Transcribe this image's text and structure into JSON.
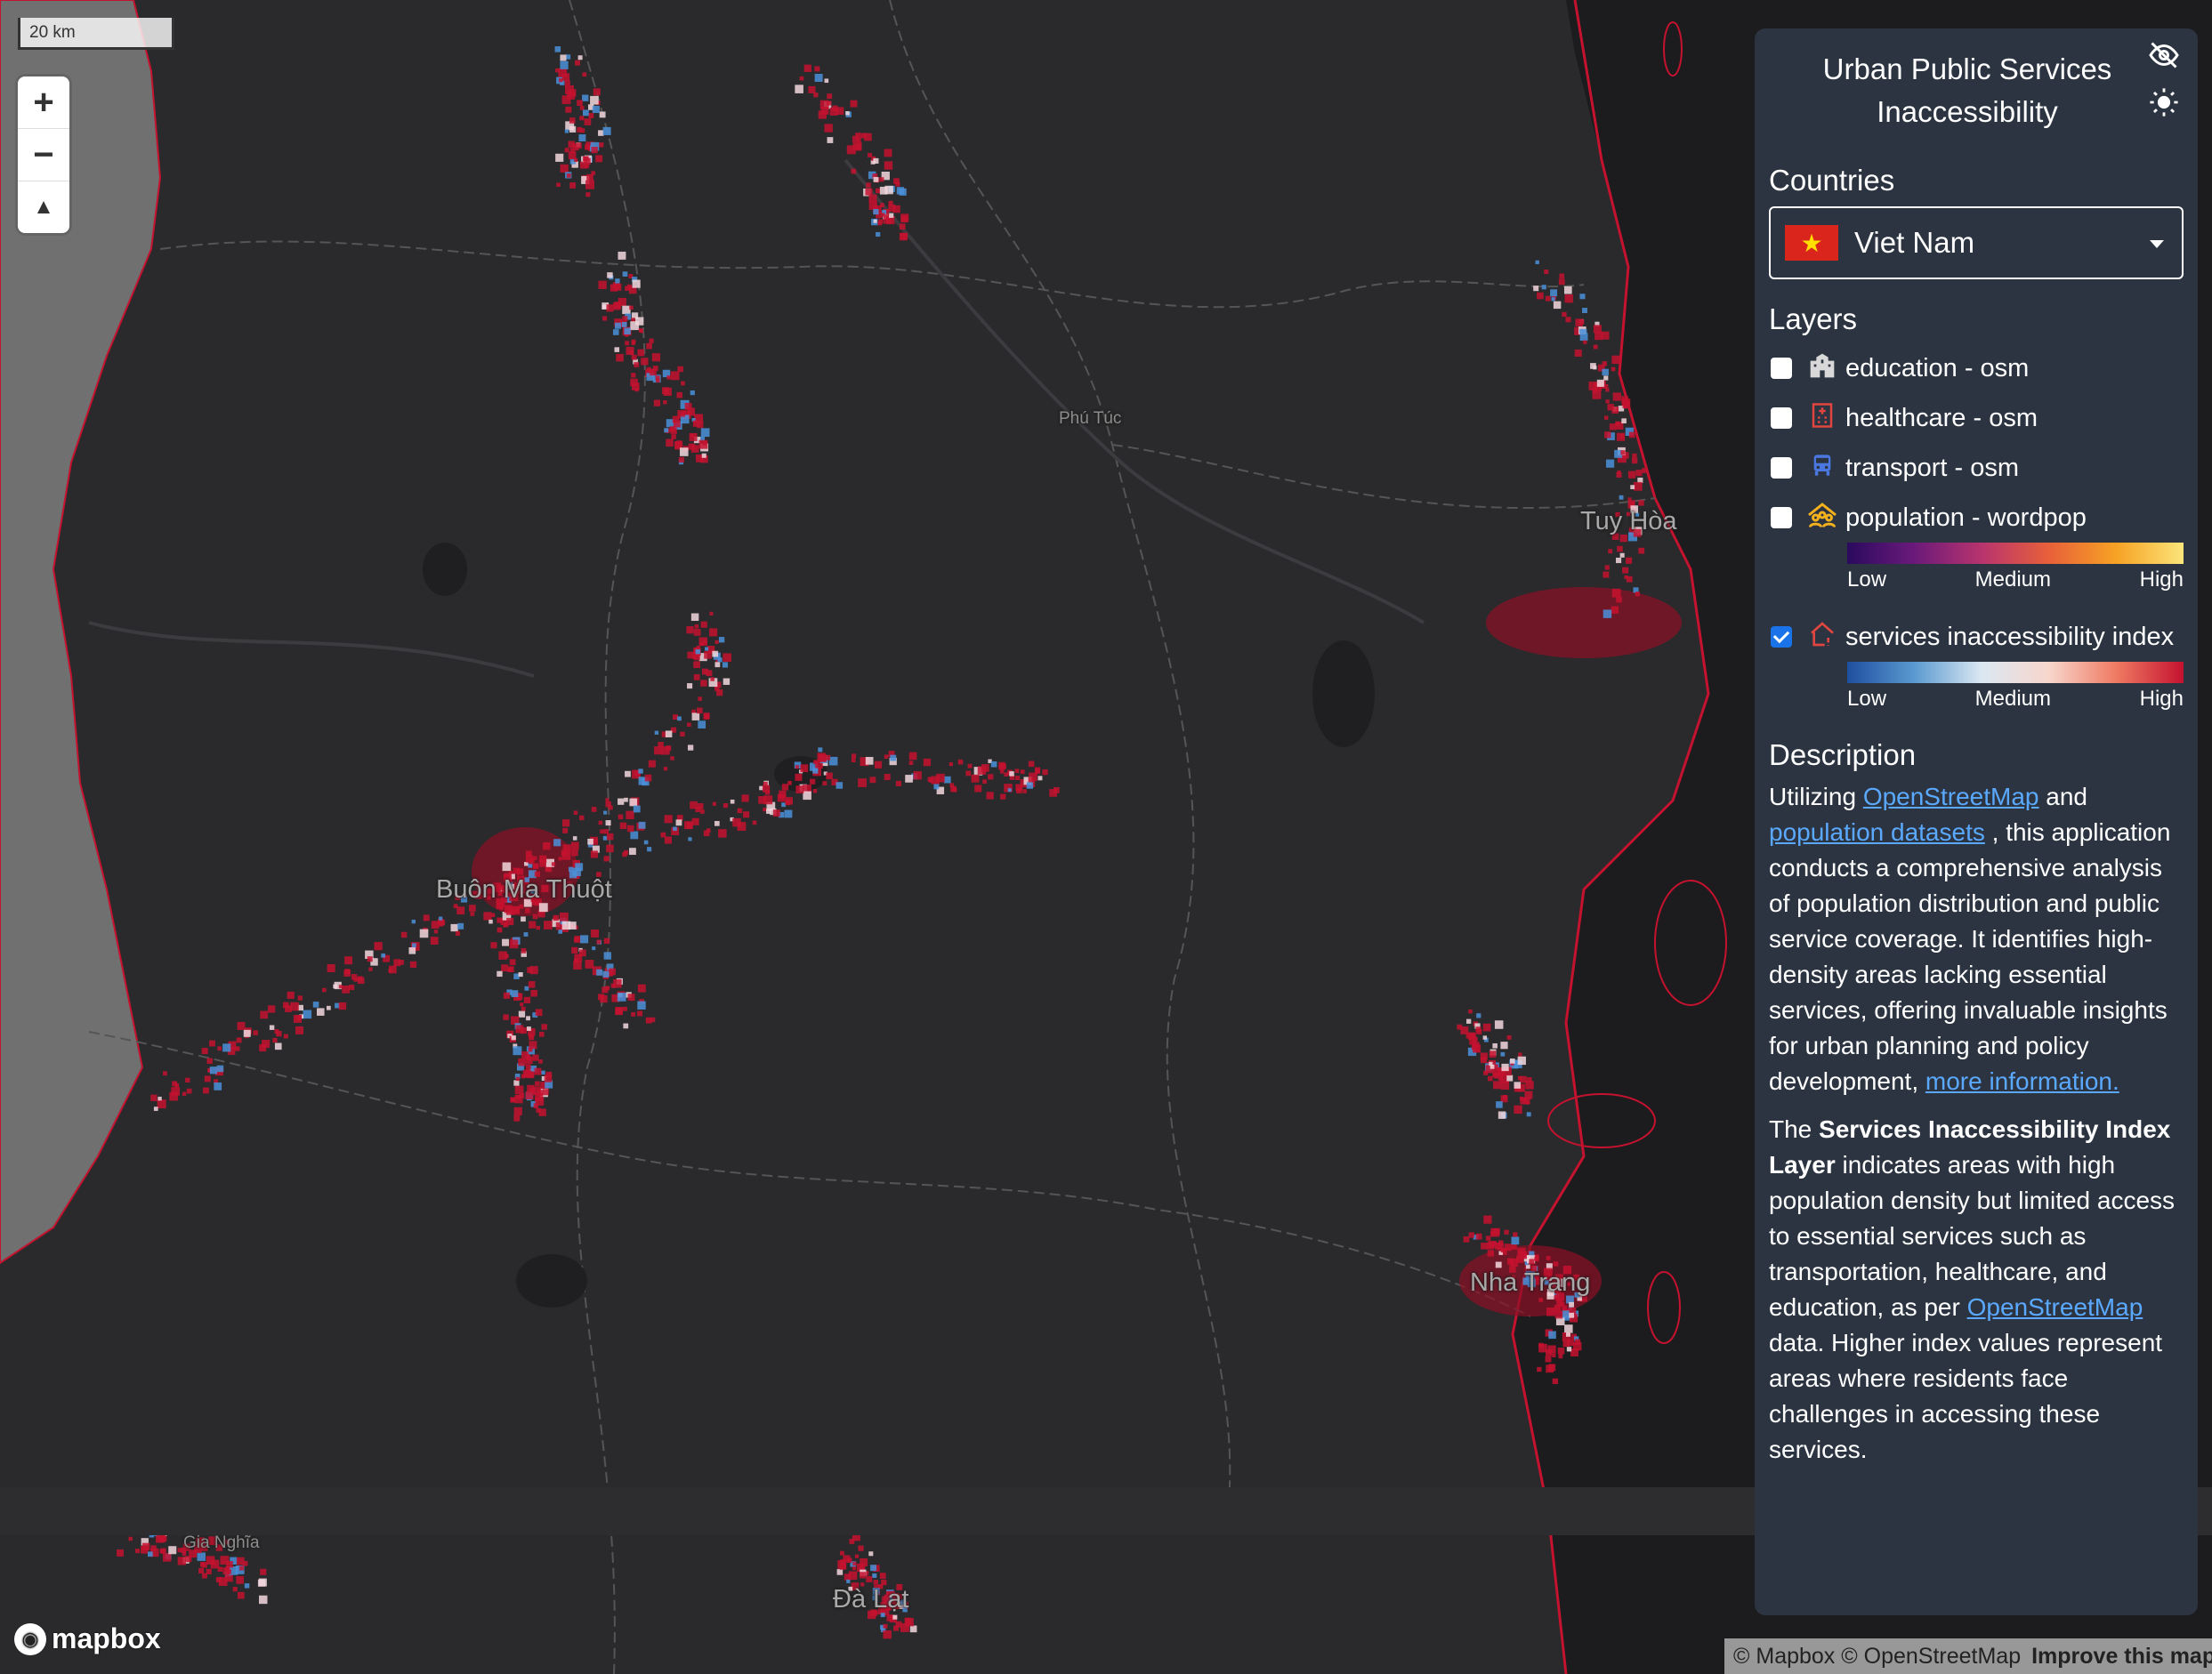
{
  "map": {
    "scale": "20 km",
    "cities": [
      {
        "name": "Phú Túc",
        "size": "small"
      },
      {
        "name": "Tuy Hòa",
        "size": "large"
      },
      {
        "name": "Buôn Ma Thuột",
        "size": "large"
      },
      {
        "name": "Nha Trang",
        "size": "large"
      },
      {
        "name": "Gia Nghĩa",
        "size": "small"
      },
      {
        "name": "Đà Lạt",
        "size": "large"
      }
    ],
    "colors": {
      "land": "#2a2a2c",
      "sea": "#1b1b1d",
      "neighbor": "#707070",
      "hotspot": "#c4122f",
      "access": "#4a90d9"
    }
  },
  "controls": {
    "zoom_in": "+",
    "zoom_out": "−",
    "compass": "▲"
  },
  "attribution": {
    "logo": "mapbox",
    "text": "© Mapbox © OpenStreetMap",
    "improve": "Improve this map"
  },
  "panel": {
    "title": "Urban Public Services Inaccessibility",
    "icons": [
      "eye-off-icon",
      "sun-icon"
    ],
    "countries_heading": "Countries",
    "country_selected": "Viet Nam",
    "layers_heading": "Layers",
    "layers": [
      {
        "label": "education - osm",
        "checked": false,
        "icon": "school-icon",
        "color": "#d8d8d8"
      },
      {
        "label": "healthcare - osm",
        "checked": false,
        "icon": "hospital-icon",
        "color": "#e0453f"
      },
      {
        "label": "transport - osm",
        "checked": false,
        "icon": "bus-icon",
        "color": "#4a78e0"
      },
      {
        "label": "population - wordpop",
        "checked": false,
        "icon": "people-icon",
        "color": "#f5b21d"
      },
      {
        "label": "services inaccessibility index",
        "checked": true,
        "icon": "house-alert-icon",
        "color": "#e0453f"
      }
    ],
    "legend_population": {
      "low": "Low",
      "medium": "Medium",
      "high": "High"
    },
    "legend_index": {
      "low": "Low",
      "medium": "Medium",
      "high": "High"
    },
    "description_heading": "Description",
    "description": {
      "p1_a": "Utilizing ",
      "p1_link1": "OpenStreetMap",
      "p1_b": " and ",
      "p1_link2": "population datasets",
      "p1_c": " , this application conducts a comprehensive analysis of population distribution and public service coverage. It identifies high-density areas lacking essential services, offering invaluable insights for urban planning and policy development, ",
      "p1_link3": "more information.",
      "p2_a": "The ",
      "p2_bold": "Services Inaccessibility Index Layer",
      "p2_b": " indicates areas with high population density but limited access to essential services such as transportation, healthcare, and education, as per ",
      "p2_link": "OpenStreetMap",
      "p2_c": " data. Higher index values represent areas where residents face challenges in accessing these services."
    }
  }
}
